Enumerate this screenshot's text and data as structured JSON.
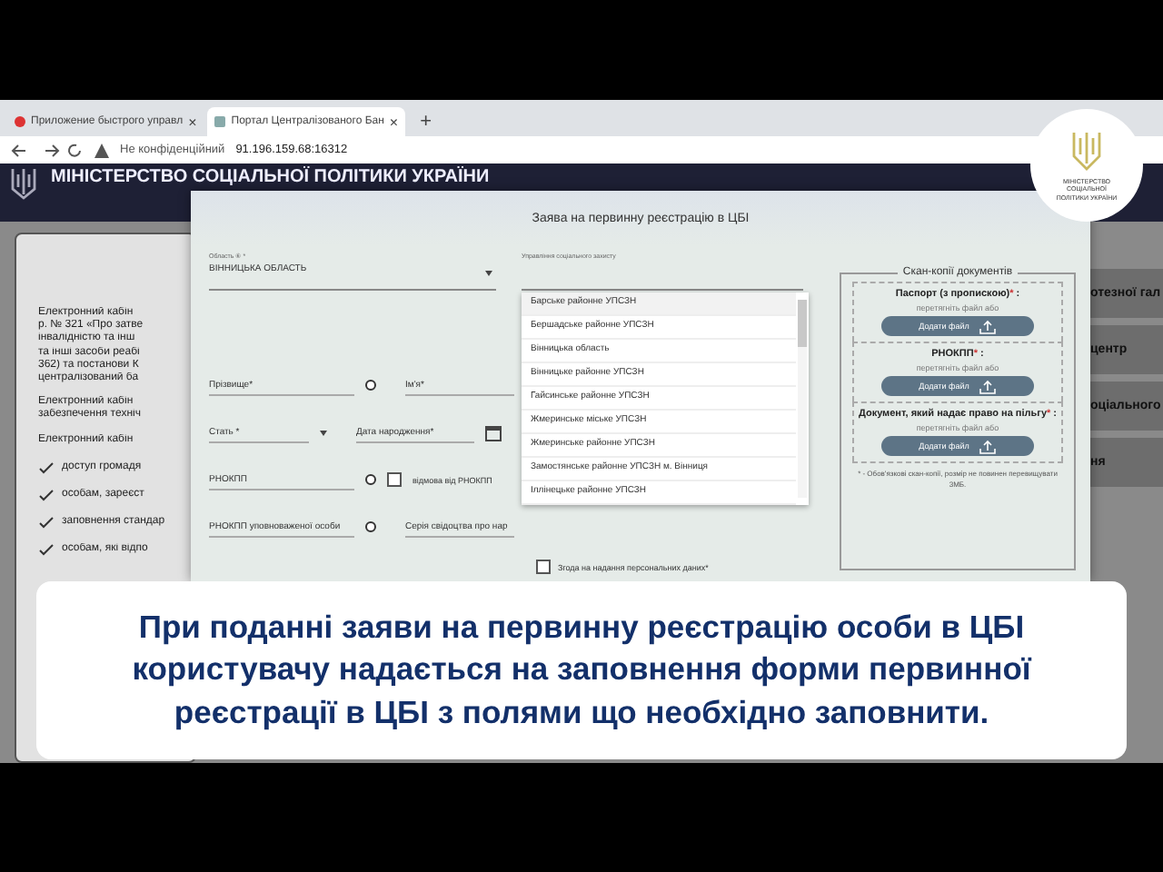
{
  "browser": {
    "tabs": [
      {
        "title": "Приложение быстрого управл",
        "selected": false
      },
      {
        "title": "Портал Централізованого Бан",
        "selected": true
      }
    ],
    "tab_close": "×",
    "new_tab": "+",
    "security": "Не конфіденційний",
    "url": "91.196.159.68:16312"
  },
  "site_header": {
    "title": "МІНІСТЕРСТВО СОЦІАЛЬНОЇ ПОЛІТИКИ УКРАЇНИ"
  },
  "background_page": {
    "paragraphs": [
      "Електронний кабін",
      "р. № 321 «Про затве",
      "інвалідністю та інш",
      "та інші засоби реабі",
      "362) та постанови К",
      "централізований ба",
      "Електронний кабін",
      "забезпечення техніч",
      "Електронний кабін"
    ],
    "bullets": [
      "доступ громадя",
      "особам, зареєст",
      "заповнення стандар",
      "особам, які відпо"
    ],
    "right_cards": [
      "отезної гал",
      "центр",
      "оціального",
      "ня"
    ]
  },
  "logo": {
    "caption": "МІНІСТЕРСТВО СОЦІАЛЬНОЇ ПОЛІТИКИ УКРАЇНИ"
  },
  "modal": {
    "title": "Заява на первинну реєстрацію в ЦБІ",
    "region_field": {
      "label": "Область ⑥*",
      "value": "ВІННИЦЬКА ОБЛАСТЬ"
    },
    "office_field": {
      "label": "Управління соціального захисту"
    },
    "office_options": [
      {
        "label": "Барське районне УПСЗН",
        "selected": true
      },
      {
        "label": "Бершадське районне УПСЗН",
        "selected": false
      },
      {
        "label": "Вінницька область",
        "selected": false
      },
      {
        "label": "Вінницьке районне УПСЗН",
        "selected": false
      },
      {
        "label": "Гайсинське районне УПСЗН",
        "selected": false
      },
      {
        "label": "Жмеринське міське УПСЗН",
        "selected": false
      },
      {
        "label": "Жмеринське районне УПСЗН",
        "selected": false
      },
      {
        "label": "Замостянське районне УПСЗН м. Вінниця",
        "selected": false
      },
      {
        "label": "Іллінецьке районне УПСЗН",
        "selected": false
      }
    ],
    "surname_placeholder": "Прізвище*",
    "name_placeholder": "Ім'я*",
    "sex_placeholder": "Стать *",
    "birth_placeholder": "Дата народження*",
    "rnokpp_placeholder": "РНОКПП",
    "refusal": {
      "label": "відмова від РНОКПП",
      "checked": false
    },
    "agent_rnokpp_placeholder": "РНОКПП уповноваженої особи",
    "certificate_placeholder": "Серія свідоцтва про нар",
    "consent": {
      "label": "Згода на надання персональних даних*",
      "checked": false
    },
    "scans": {
      "legend": "Скан-копії документів",
      "documents": [
        {
          "title": "Паспорт (з пропискою)",
          "hint": "перетягніть файл або",
          "button": "Додати файл"
        },
        {
          "title": "РНОКПП",
          "hint": "перетягніть файл або",
          "button": "Додати файл"
        },
        {
          "title": "Документ, який надає право на пільгу",
          "hint": "перетягніть файл або",
          "button": "Додати файл"
        }
      ],
      "required_mark": "*",
      "colon": ":",
      "note": "* - Обов'язкові скан-копії, розмір не повинен перевищувати 3МБ."
    }
  },
  "caption": "При поданні заяви на первинну реєстрацію особи в ЦБІ користувачу надається на заповнення форми первинної реєстрації в ЦБІ з полями що необхідно заповнити."
}
